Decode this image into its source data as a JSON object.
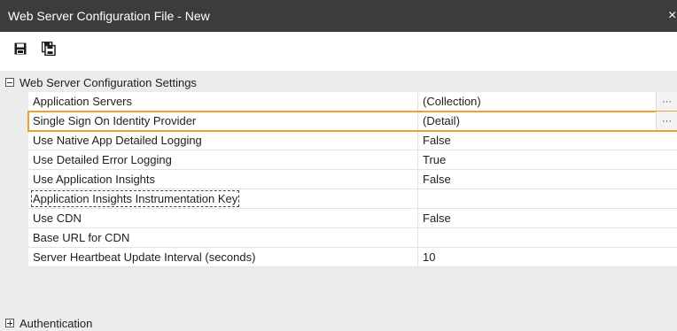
{
  "window": {
    "title": "Web Server Configuration File - New",
    "close_glyph": "×"
  },
  "toolbar": {
    "items": [
      {
        "icon": "save-icon"
      },
      {
        "icon": "save-as-icon"
      }
    ]
  },
  "categories": [
    {
      "label": "Web Server Configuration Settings",
      "expanded": true,
      "properties": [
        {
          "name": "Application Servers",
          "value": "(Collection)",
          "has_button": true,
          "button_label": "···"
        },
        {
          "name": "Single Sign On Identity Provider",
          "value": "(Detail)",
          "has_button": true,
          "button_label": "···",
          "selected": true
        },
        {
          "name": "Use Native App Detailed Logging",
          "value": "False"
        },
        {
          "name": "Use Detailed Error Logging",
          "value": "True"
        },
        {
          "name": "Use Application Insights",
          "value": "False"
        },
        {
          "name": "Application Insights Instrumentation Key",
          "value": "",
          "focused": true
        },
        {
          "name": "Use CDN",
          "value": "False"
        },
        {
          "name": "Base URL for CDN",
          "value": ""
        },
        {
          "name": "Server Heartbeat Update Interval (seconds)",
          "value": "10"
        }
      ]
    },
    {
      "label": "Authentication",
      "expanded": false
    }
  ]
}
